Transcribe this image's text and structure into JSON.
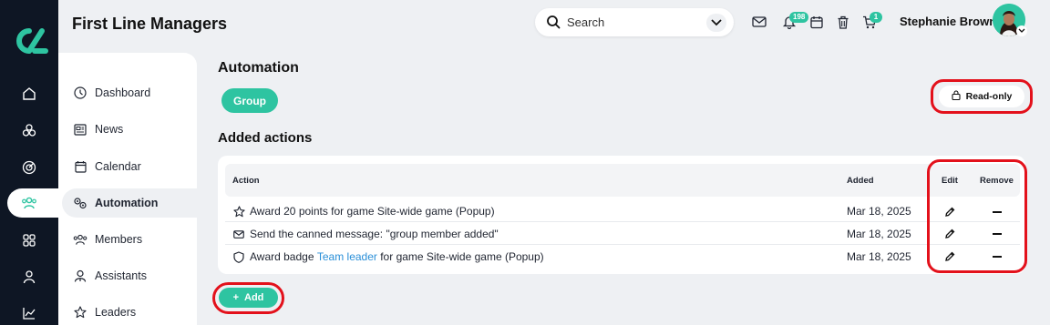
{
  "app": {
    "page_title": "First Line Managers",
    "brand_color": "#2ec4a1",
    "highlight_color": "#e3111b"
  },
  "header": {
    "search_placeholder": "Search",
    "notifications_count": "198",
    "cart_count": "1",
    "user_name": "Stephanie Brown",
    "icons": [
      "search-icon",
      "chevron-down-icon",
      "mail-icon",
      "bell-icon",
      "calendar-icon",
      "trash-icon",
      "cart-icon"
    ]
  },
  "rail": {
    "icons": [
      "home-icon",
      "cubes-icon",
      "target-icon",
      "users-icon",
      "grid-icon",
      "person-icon",
      "chart-icon"
    ],
    "active": "users-icon"
  },
  "sidebar": {
    "items": [
      {
        "label": "Dashboard",
        "icon": "dashboard-icon"
      },
      {
        "label": "News",
        "icon": "news-icon"
      },
      {
        "label": "Calendar",
        "icon": "calendar-icon"
      },
      {
        "label": "Automation",
        "icon": "automation-icon",
        "active": true
      },
      {
        "label": "Members",
        "icon": "members-icon"
      },
      {
        "label": "Assistants",
        "icon": "assistant-icon"
      },
      {
        "label": "Leaders",
        "icon": "star-icon"
      }
    ]
  },
  "main": {
    "section_title": "Automation",
    "group_button": "Group",
    "readonly_label": "Read-only",
    "actions_title": "Added actions",
    "columns": {
      "action": "Action",
      "added": "Added",
      "edit": "Edit",
      "remove": "Remove"
    },
    "rows": [
      {
        "icon": "star-icon",
        "text_before": "Award 20 points for game Site-wide game (Popup)",
        "link": "",
        "text_after": "",
        "added": "Mar 18, 2025"
      },
      {
        "icon": "mail-icon",
        "text_before": "Send the canned message: \"group member added\"",
        "link": "",
        "text_after": "",
        "added": "Mar 18, 2025"
      },
      {
        "icon": "shield-icon",
        "text_before": "Award badge ",
        "link": "Team leader",
        "text_after": " for game Site-wide game (Popup)",
        "added": "Mar 18, 2025"
      }
    ],
    "add_button": "Add",
    "add_symbol": "+"
  }
}
